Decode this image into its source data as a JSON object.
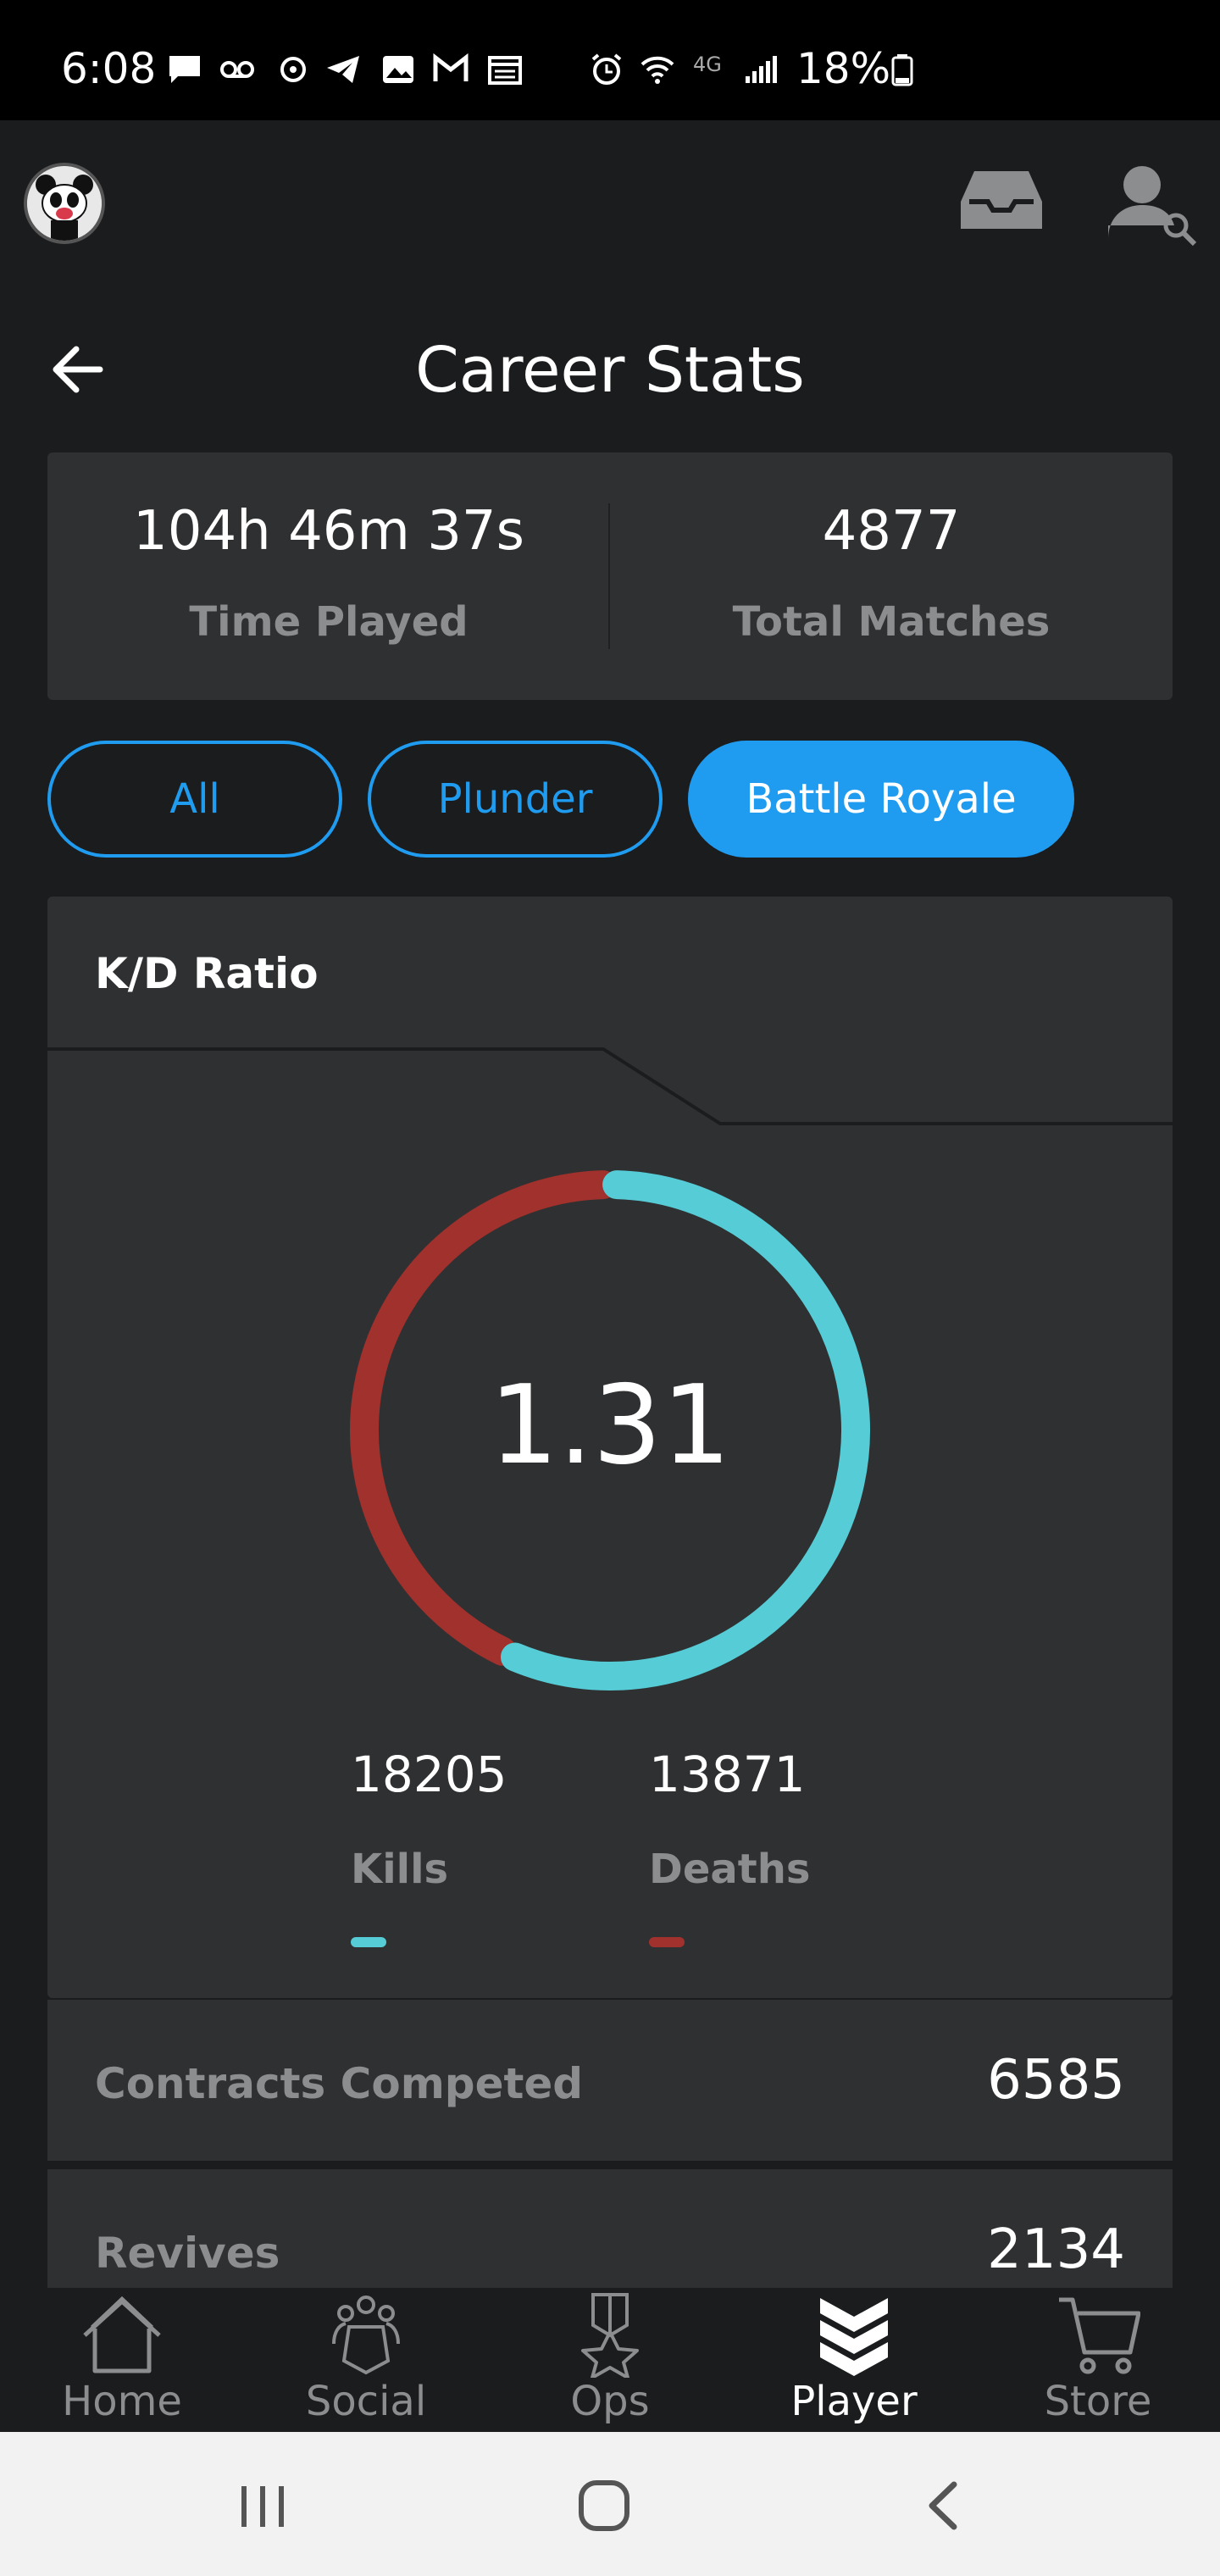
{
  "status_bar": {
    "time": "6:08",
    "battery": "18%",
    "icons": [
      "message-icon",
      "voicemail-icon",
      "settings-dot-icon",
      "telegram-icon",
      "gallery-icon",
      "gmail-icon",
      "calendar-icon",
      "alarm-icon",
      "wifi-icon",
      "4g-icon",
      "signal-icon",
      "battery-icon"
    ]
  },
  "header": {
    "title": "Career Stats"
  },
  "summary": {
    "time_played_value": "104h 46m 37s",
    "time_played_label": "Time Played",
    "total_matches_value": "4877",
    "total_matches_label": "Total Matches"
  },
  "filters": {
    "items": [
      {
        "label": "All",
        "active": false
      },
      {
        "label": "Plunder",
        "active": false
      },
      {
        "label": "Battle Royale",
        "active": true
      }
    ],
    "accent": "#1f9cf0"
  },
  "kd": {
    "title": "K/D Ratio",
    "ratio": "1.31",
    "kills_value": "18205",
    "kills_label": "Kills",
    "deaths_value": "13871",
    "deaths_label": "Deaths",
    "kills_color": "#56ccd6",
    "deaths_color": "#a0312c"
  },
  "stats": [
    {
      "label": "Contracts Competed",
      "value": "6585"
    },
    {
      "label": "Revives",
      "value": "2134"
    }
  ],
  "bottom_nav": {
    "items": [
      {
        "label": "Home",
        "icon": "home-icon",
        "active": false
      },
      {
        "label": "Social",
        "icon": "social-icon",
        "active": false
      },
      {
        "label": "Ops",
        "icon": "ops-medal-icon",
        "active": false
      },
      {
        "label": "Player",
        "icon": "player-chevrons-icon",
        "active": true
      },
      {
        "label": "Store",
        "icon": "cart-icon",
        "active": false
      }
    ]
  },
  "system_nav": {
    "icons": [
      "recents-icon",
      "home-circle-icon",
      "system-back-icon"
    ]
  }
}
